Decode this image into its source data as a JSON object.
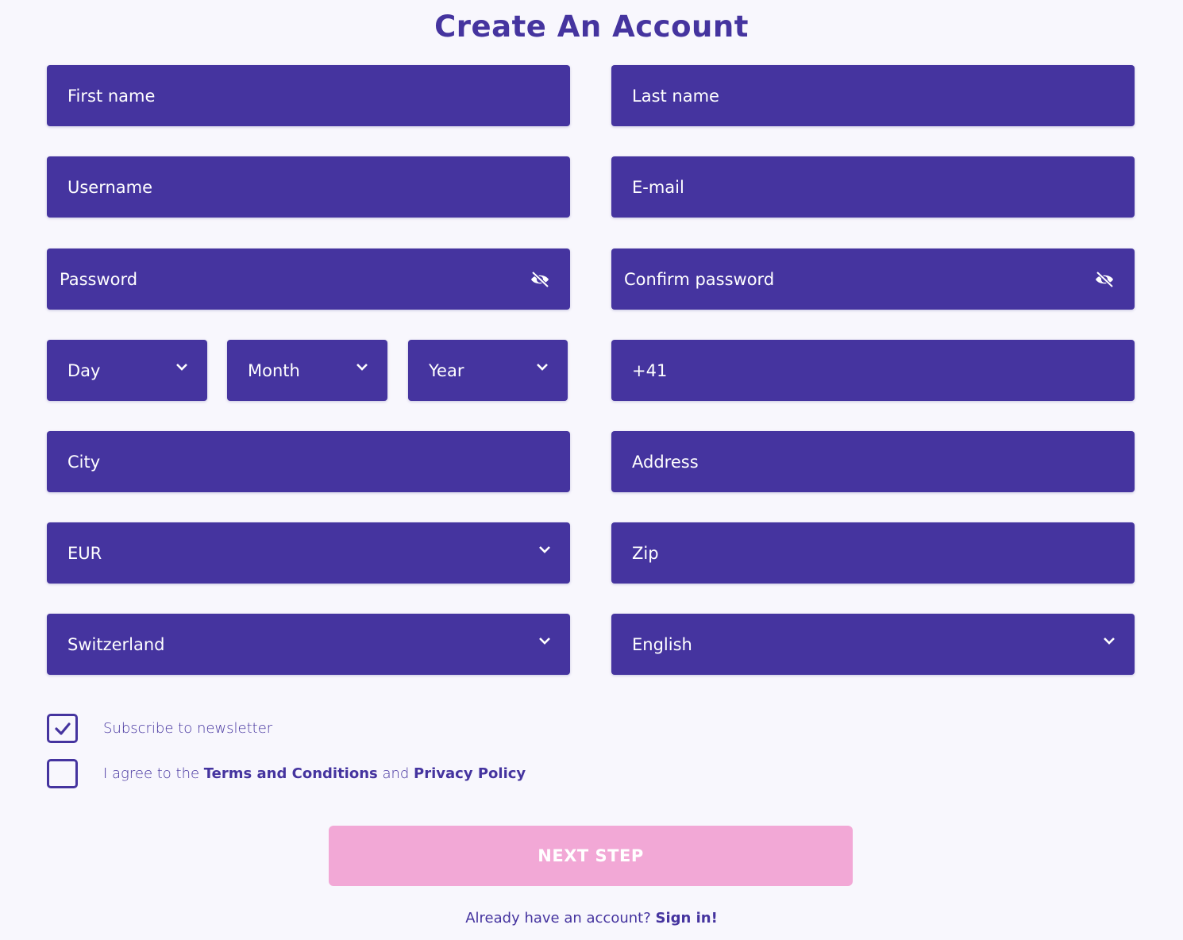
{
  "page": {
    "title": "Create An Account"
  },
  "form": {
    "first_name": {
      "placeholder": "First name",
      "value": ""
    },
    "last_name": {
      "placeholder": "Last name",
      "value": ""
    },
    "username": {
      "placeholder": "Username",
      "value": ""
    },
    "email": {
      "placeholder": "E-mail",
      "value": ""
    },
    "password": {
      "placeholder": "Password",
      "value": "",
      "icon": "eye-slash-icon"
    },
    "confirm_password": {
      "placeholder": "Confirm password",
      "value": "",
      "icon": "eye-slash-icon"
    },
    "day": {
      "selected": "Day"
    },
    "month": {
      "selected": "Month"
    },
    "year": {
      "selected": "Year"
    },
    "phone": {
      "value": "+41"
    },
    "city": {
      "placeholder": "City",
      "value": ""
    },
    "address": {
      "placeholder": "Address",
      "value": ""
    },
    "currency": {
      "selected": "EUR"
    },
    "zip": {
      "placeholder": "Zip",
      "value": ""
    },
    "country": {
      "selected": "Switzerland"
    },
    "language": {
      "selected": "English"
    }
  },
  "checkboxes": {
    "newsletter": {
      "label": "Subscribe to newsletter",
      "checked": true
    },
    "terms": {
      "checked": false,
      "prefix": "I agree to the ",
      "terms_link": "Terms and Conditions",
      "middle": " and ",
      "privacy_link": "Privacy Policy"
    }
  },
  "actions": {
    "next_step_label": "NEXT STEP",
    "signin_prompt": "Already have an account? ",
    "signin_link": "Sign in!"
  },
  "colors": {
    "primary": "#45349f",
    "background": "#f8f7fd",
    "button_disabled": "#f2a8d6",
    "text_on_primary": "#ffffff"
  }
}
